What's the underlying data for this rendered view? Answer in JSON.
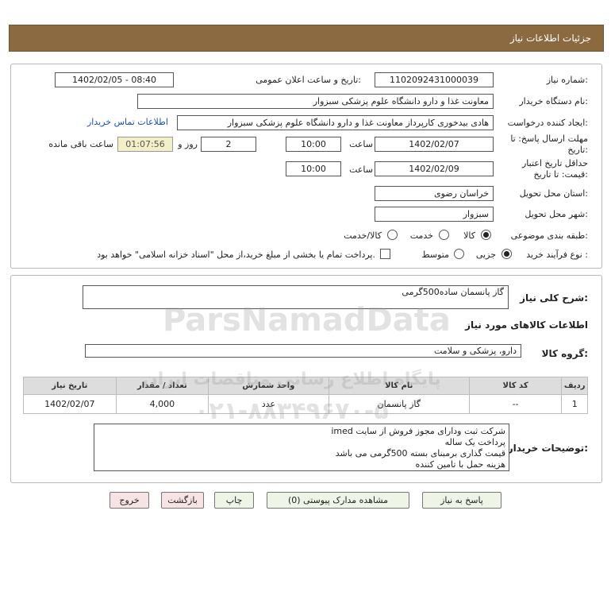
{
  "header": {
    "title": "جزئیات اطلاعات نیاز"
  },
  "form": {
    "need_number_label": "شماره نیاز:",
    "need_number": "1102092431000039",
    "announce_label": "تاریخ و ساعت اعلان عمومی:",
    "announce_value": "1402/02/05 - 08:40",
    "buyer_org_label": "نام دستگاه خریدار:",
    "buyer_org": "معاونت غذا و دارو   دانشگاه علوم پزشکی سبزوار",
    "requester_label": "ایجاد کننده درخواست:",
    "requester": "هادی بیدخوری کارپرداز معاونت غذا و دارو   دانشگاه علوم پزشکی سبزوار",
    "contact_link": "اطلاعات تماس خریدار",
    "deadline_label_1": "مهلت ارسال پاسخ: تا",
    "deadline_label_2": "تاریخ:",
    "deadline_date": "1402/02/07",
    "time_label": "ساعت",
    "deadline_time": "10:00",
    "days_value": "2",
    "days_label": "روز و",
    "remaining_value": "01:07:56",
    "remaining_label": "ساعت باقی مانده",
    "validity_label_1": "حداقل تاریخ اعتبار",
    "validity_label_2": "قیمت: تا تاریخ:",
    "validity_date": "1402/02/09",
    "validity_time": "10:00",
    "province_label": "استان محل تحویل:",
    "province": "خراسان رضوی",
    "city_label": "شهر محل تحویل:",
    "city": "سبزوار",
    "category_label": "طبقه بندی موضوعی:",
    "category_options": [
      "کالا",
      "خدمت",
      "کالا/خدمت"
    ],
    "process_label": "نوع فرآیند خرید :",
    "process_options": [
      "جزیی",
      "متوسط"
    ],
    "payment_note": "پرداخت تمام یا بخشی از مبلغ خرید،از محل \"اسناد خزانه اسلامی\" خواهد بود."
  },
  "description": {
    "label": "شرح کلی نیاز:",
    "value": "گاز پانسمان ساده500گرمی"
  },
  "goods": {
    "section_title": "اطلاعات کالاهای مورد نیاز",
    "group_label": "گروه کالا:",
    "group_value": "دارو، پزشکی و سلامت",
    "columns": [
      "ردیف",
      "کد کالا",
      "نام کالا",
      "واحد شمارش",
      "تعداد / مقدار",
      "تاریخ نیاز"
    ],
    "rows": [
      {
        "row": "1",
        "code": "--",
        "name": "گاز پانسمان",
        "unit": "عدد",
        "qty": "4,000",
        "date": "1402/02/07"
      }
    ]
  },
  "notes": {
    "label": "توضیحات خریدار:",
    "lines": [
      "شرکت ثبت ودارای مجوز فروش از سایت imed",
      "پرداخت یک ساله",
      "قیمت گذاری برمبنای بسته 500گرمی می باشد",
      "هزینه حمل با تامین کننده"
    ]
  },
  "buttons": {
    "reply": "پاسخ به نیاز",
    "attachments": "مشاهده مدارک پیوستی (0)",
    "print": "چاپ",
    "back": "بازگشت",
    "exit": "خروج"
  },
  "watermark": {
    "line1": "ParsNamadData",
    "line2": "پایگاه اطلاع رسانی مناقصات ایران",
    "phone": "۰۲۱-۸۸۳۴۹۶۷۰-۵"
  }
}
